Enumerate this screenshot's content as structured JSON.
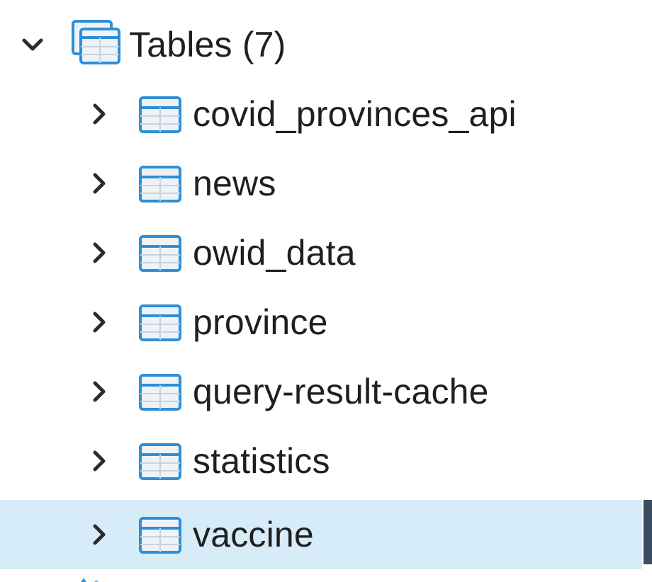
{
  "tree": {
    "group": {
      "label": "Tables (7)",
      "expanded": true,
      "icon": "tables-group-icon"
    },
    "items": [
      {
        "label": "covid_provinces_api",
        "icon": "table-icon",
        "selected": false
      },
      {
        "label": "news",
        "icon": "table-icon",
        "selected": false
      },
      {
        "label": "owid_data",
        "icon": "table-icon",
        "selected": false
      },
      {
        "label": "province",
        "icon": "table-icon",
        "selected": false
      },
      {
        "label": "query-result-cache",
        "icon": "table-icon",
        "selected": false
      },
      {
        "label": "statistics",
        "icon": "table-icon",
        "selected": false
      },
      {
        "label": "vaccine",
        "icon": "table-icon",
        "selected": true
      }
    ]
  },
  "colors": {
    "selection_bg": "#d6ecf8",
    "selection_marker": "#3a4d63",
    "icon_stroke": "#2f8fd6",
    "icon_fill": "#eef3f8",
    "chevron": "#2b2b2b"
  }
}
